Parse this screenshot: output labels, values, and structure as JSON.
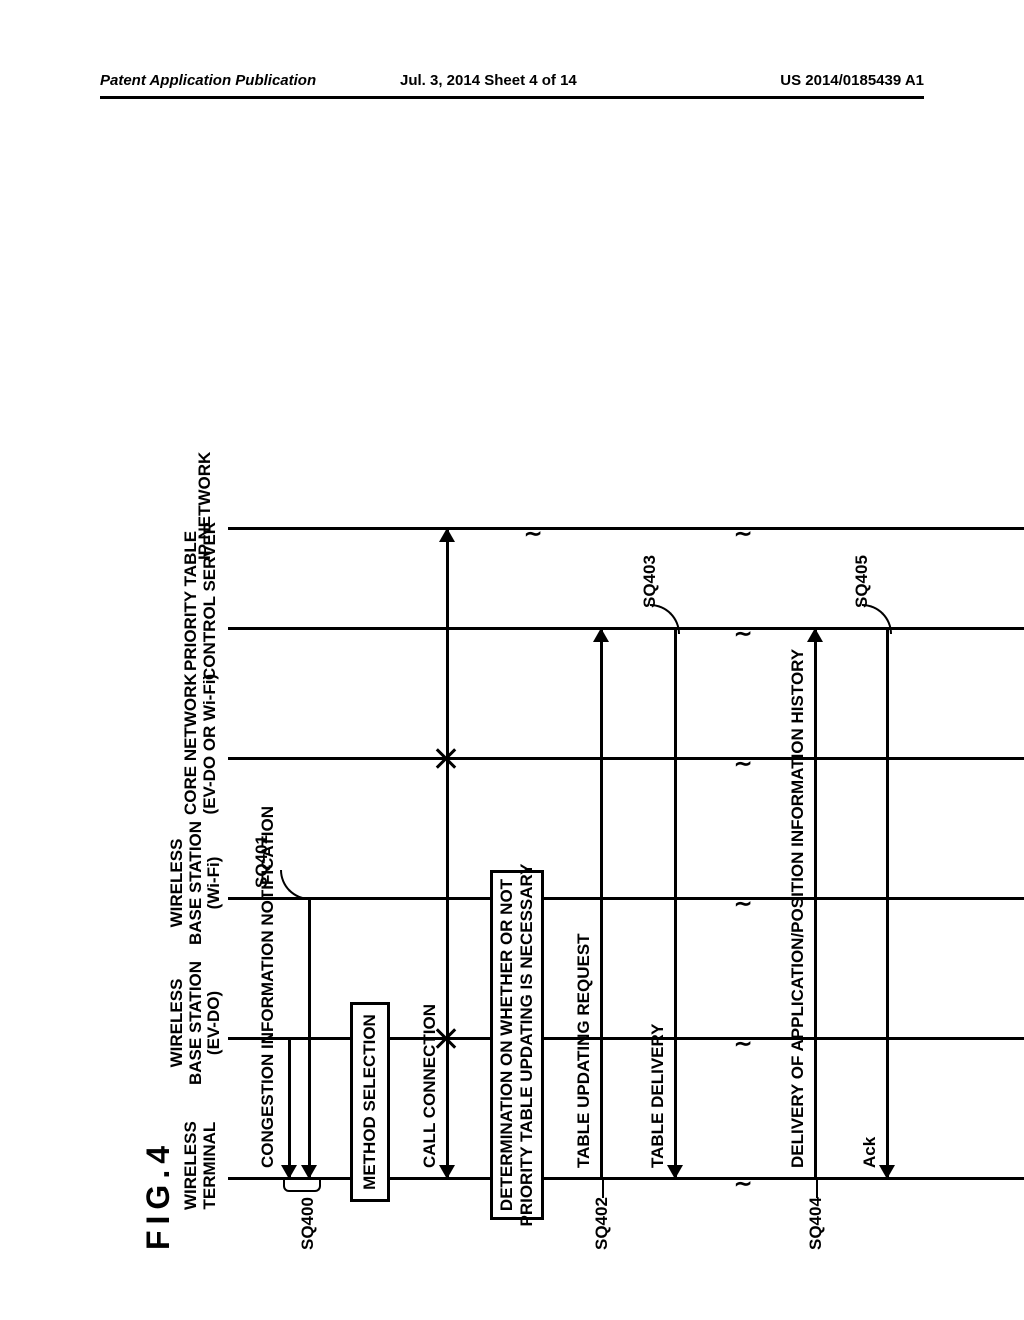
{
  "header": {
    "left": "Patent Application Publication",
    "center": "Jul. 3, 2014   Sheet 4 of 14",
    "right": "US 2014/0185439 A1"
  },
  "figure_label": "FIG.4",
  "actors": {
    "terminal": "WIRELESS\nTERMINAL",
    "bs_evdo": "WIRELESS\nBASE STATION\n(EV-DO)",
    "bs_wifi": "WIRELESS\nBASE STATION\n(Wi-Fi)",
    "core": "CORE NETWORK\n(EV-DO OR Wi-Fi)",
    "priority": "PRIORITY TABLE\nCONTROL SERVER",
    "ipnet": "IP NETWORK"
  },
  "messages": {
    "congestion": "CONGESTION INFORMATION NOTIFICATION",
    "method_selection": "METHOD SELECTION",
    "call_connection": "CALL CONNECTION",
    "determination": "DETERMINATION ON WHETHER OR NOT\nPRIORITY TABLE UPDATING IS NECESSARY",
    "table_updating_request": "TABLE UPDATING REQUEST",
    "table_delivery": "TABLE DELIVERY",
    "delivery_history": "DELIVERY OF APPLICATION/POSITION INFORMATION HISTORY",
    "ack": "Ack"
  },
  "sequence_ids": {
    "sq400": "SQ400",
    "sq401": "SQ401",
    "sq402": "SQ402",
    "sq403": "SQ403",
    "sq404": "SQ404",
    "sq405": "SQ405"
  },
  "chart_data": {
    "type": "sequence-diagram",
    "title": "FIG.4",
    "actors": [
      "WIRELESS TERMINAL",
      "WIRELESS BASE STATION (EV-DO)",
      "WIRELESS BASE STATION (Wi-Fi)",
      "CORE NETWORK (EV-DO OR Wi-Fi)",
      "PRIORITY TABLE CONTROL SERVER",
      "IP NETWORK"
    ],
    "messages": [
      {
        "id": "SQ400",
        "from": "WIRELESS BASE STATION (EV-DO)",
        "to": "WIRELESS TERMINAL",
        "label": "CONGESTION INFORMATION NOTIFICATION"
      },
      {
        "id": "SQ401",
        "from": "WIRELESS BASE STATION (Wi-Fi)",
        "to": "WIRELESS TERMINAL",
        "label": "CONGESTION INFORMATION NOTIFICATION"
      },
      {
        "id": null,
        "from": "WIRELESS TERMINAL",
        "to": "WIRELESS TERMINAL",
        "label": "METHOD SELECTION",
        "kind": "self-action"
      },
      {
        "id": null,
        "from": "WIRELESS TERMINAL",
        "to": "IP NETWORK",
        "label": "CALL CONNECTION",
        "via": [
          "WIRELESS BASE STATION (EV-DO)",
          "CORE NETWORK (EV-DO OR Wi-Fi)"
        ]
      },
      {
        "id": null,
        "from": "WIRELESS TERMINAL",
        "to": "WIRELESS TERMINAL",
        "label": "DETERMINATION ON WHETHER OR NOT PRIORITY TABLE UPDATING IS NECESSARY",
        "kind": "self-action"
      },
      {
        "id": "SQ402",
        "from": "WIRELESS TERMINAL",
        "to": "PRIORITY TABLE CONTROL SERVER",
        "label": "TABLE UPDATING REQUEST"
      },
      {
        "id": "SQ403",
        "from": "PRIORITY TABLE CONTROL SERVER",
        "to": "WIRELESS TERMINAL",
        "label": "TABLE DELIVERY"
      },
      {
        "id": "SQ404",
        "from": "WIRELESS TERMINAL",
        "to": "PRIORITY TABLE CONTROL SERVER",
        "label": "DELIVERY OF APPLICATION/POSITION INFORMATION HISTORY"
      },
      {
        "id": "SQ405",
        "from": "PRIORITY TABLE CONTROL SERVER",
        "to": "WIRELESS TERMINAL",
        "label": "Ack"
      }
    ],
    "time_break_after": [
      "SQ403",
      "IP NETWORK after CALL CONNECTION"
    ]
  }
}
